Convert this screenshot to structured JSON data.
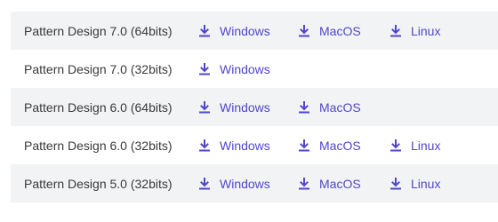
{
  "colors": {
    "link": "#5146c9",
    "row_shade": "#f2f3f5",
    "text": "#3a3a3a"
  },
  "icon": "download-icon",
  "rows": [
    {
      "name": "Pattern Design 7.0 (64bits)",
      "shaded": true,
      "links": {
        "windows": "Windows",
        "macos": "MacOS",
        "linux": "Linux"
      }
    },
    {
      "name": "Pattern Design 7.0 (32bits)",
      "shaded": false,
      "links": {
        "windows": "Windows"
      }
    },
    {
      "name": "Pattern Design 6.0 (64bits)",
      "shaded": true,
      "links": {
        "windows": "Windows",
        "macos": "MacOS"
      }
    },
    {
      "name": "Pattern Design 6.0 (32bits)",
      "shaded": false,
      "links": {
        "windows": "Windows",
        "macos": "MacOS",
        "linux": "Linux"
      }
    },
    {
      "name": "Pattern Design 5.0 (32bits)",
      "shaded": true,
      "links": {
        "windows": "Windows",
        "macos": "MacOS",
        "linux": "Linux"
      }
    }
  ]
}
